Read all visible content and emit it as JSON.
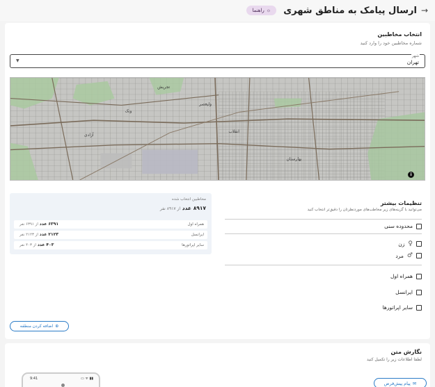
{
  "header": {
    "title": "ارسال پیامک به مناطق شهری",
    "guide_label": "راهنما",
    "back_icon": "arrow-right-icon",
    "guide_icon": "lightbulb-icon"
  },
  "audience": {
    "title": "انتخاب مخاطبین",
    "subtitle": "شماره مخاطبین خود را وارد کنید",
    "city_label": "شهر",
    "city_value": "تهران"
  },
  "map": {
    "labels": [
      "ونک",
      "تجریش",
      "آزادی",
      "انقلاب",
      "ولیعصر",
      "بهارستان"
    ],
    "info_symbol": "i"
  },
  "settings": {
    "title": "تنظیمات بیشتر",
    "subtitle": "می‌توانید با گزینه‌های زیر مخاطب‌های موردنظرتان را دقیق‌تر انتخاب کنید",
    "age_label": "محدوده سنی",
    "female_label": "زن",
    "male_label": "مرد",
    "operators": [
      "همراه اول",
      "ایرانسل",
      "سایر اپراتورها"
    ]
  },
  "summary": {
    "title": "مخاطبین انتخاب شده",
    "total_value": "۸۹۱۷",
    "count_word": "عدد",
    "of_text": "از ۸۹۱۷ نفر",
    "rows": [
      {
        "name": "همراه اول",
        "value": "۶۳۹۱",
        "of_text": "از ۶۳۹۱ نفر"
      },
      {
        "name": "ایرانسل",
        "value": "۲۱۲۳",
        "of_text": "از ۲۱۲۳ نفر"
      },
      {
        "name": "سایر اپراتورها",
        "value": "۴۰۳",
        "of_text": "از ۴۰۳ نفر"
      }
    ]
  },
  "add_region_label": "اضافه کردن منطقه",
  "compose": {
    "title": "نگارش متن",
    "subtitle": "لطفا اطلاعات زیر را تکمیل کنید",
    "preset_label": "پیام پیش‌فرض",
    "phone_time": "9:41",
    "phone_status": "▮▮ ᯤ ▭"
  },
  "colors": {
    "accent": "#2a7bc7",
    "guide_bg": "#e9d9ee"
  }
}
